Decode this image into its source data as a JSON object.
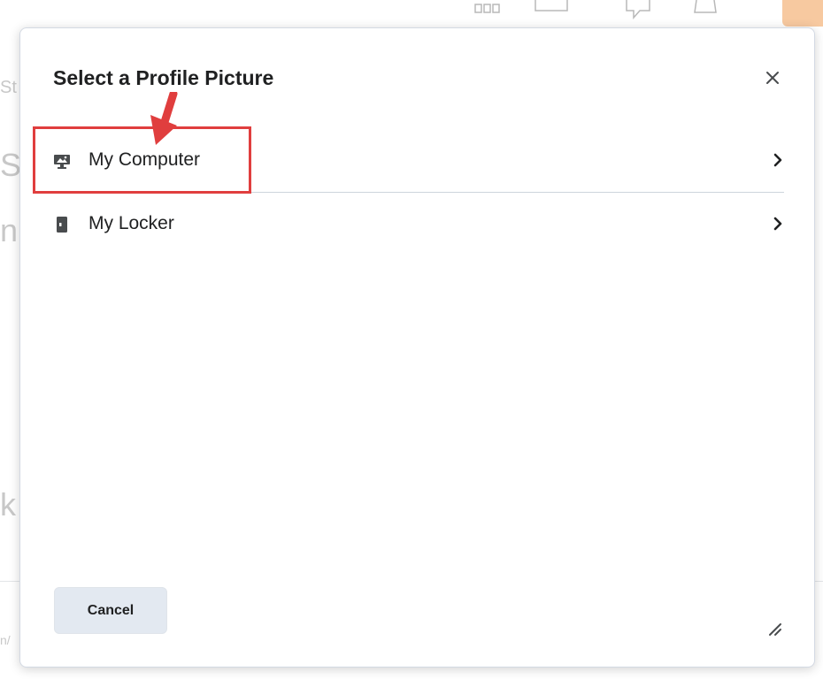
{
  "dialog": {
    "title": "Select a Profile Picture",
    "close_icon": "close-icon",
    "options": [
      {
        "label": "My Computer",
        "icon": "computer-icon",
        "highlighted": true
      },
      {
        "label": "My Locker",
        "icon": "locker-icon",
        "highlighted": false
      }
    ],
    "cancel_label": "Cancel"
  },
  "annotation": {
    "color": "#e03e3e"
  },
  "background": {
    "letters": [
      "St",
      "S",
      "n",
      "k",
      "n/"
    ]
  }
}
